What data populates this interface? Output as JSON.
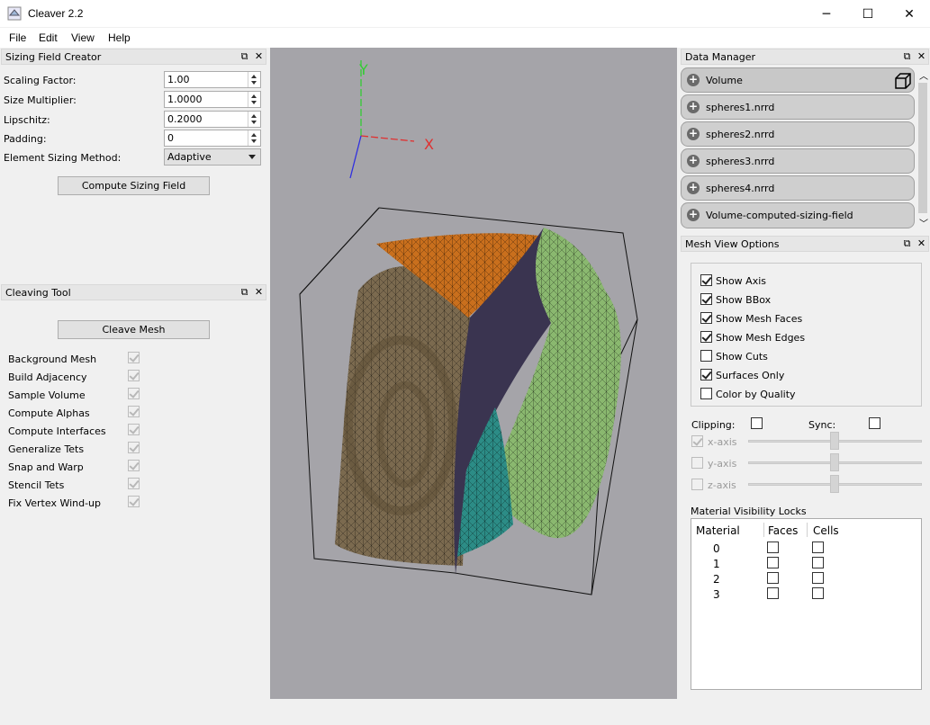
{
  "window": {
    "title": "Cleaver 2.2",
    "minimize": "─",
    "maximize": "☐",
    "close": "✕"
  },
  "menu": [
    "File",
    "Edit",
    "View",
    "Help"
  ],
  "sizing": {
    "title": "Sizing Field Creator",
    "scaling_label": "Scaling Factor:",
    "scaling_value": "1.00",
    "size_label": "Size Multiplier:",
    "size_value": "1.0000",
    "lipschitz_label": "Lipschitz:",
    "lipschitz_value": "0.2000",
    "padding_label": "Padding:",
    "padding_value": "0",
    "method_label": "Element Sizing Method:",
    "method_value": "Adaptive",
    "compute_button": "Compute Sizing Field"
  },
  "cleaving": {
    "title": "Cleaving Tool",
    "cleave_button": "Cleave Mesh",
    "steps": [
      "Background Mesh",
      "Build Adjacency",
      "Sample Volume",
      "Compute Alphas",
      "Compute Interfaces",
      "Generalize Tets",
      "Snap and Warp",
      "Stencil Tets",
      "Fix Vertex Wind-up"
    ]
  },
  "viewport": {
    "axis_x": "X",
    "axis_y": "Y",
    "background": "#a5a4a9"
  },
  "data_manager": {
    "title": "Data Manager",
    "items": [
      "Volume",
      "spheres1.nrrd",
      "spheres2.nrrd",
      "spheres3.nrrd",
      "spheres4.nrrd",
      "Volume-computed-sizing-field"
    ]
  },
  "mesh_view": {
    "title": "Mesh View Options",
    "options": [
      {
        "label": "Show Axis",
        "checked": true
      },
      {
        "label": "Show BBox",
        "checked": true
      },
      {
        "label": "Show Mesh Faces",
        "checked": true
      },
      {
        "label": "Show Mesh Edges",
        "checked": true
      },
      {
        "label": "Show Cuts",
        "checked": false
      },
      {
        "label": "Surfaces Only",
        "checked": true
      },
      {
        "label": "Color by Quality",
        "checked": false
      }
    ],
    "clipping_label": "Clipping:",
    "sync_label": "Sync:",
    "axes": [
      {
        "label": "x-axis",
        "checked": true
      },
      {
        "label": "y-axis",
        "checked": false
      },
      {
        "label": "z-axis",
        "checked": false
      }
    ]
  },
  "material_locks": {
    "title": "Material Visibility Locks",
    "headers": [
      "Material",
      "Faces",
      "Cells"
    ],
    "rows": [
      "0",
      "1",
      "2",
      "3"
    ]
  }
}
